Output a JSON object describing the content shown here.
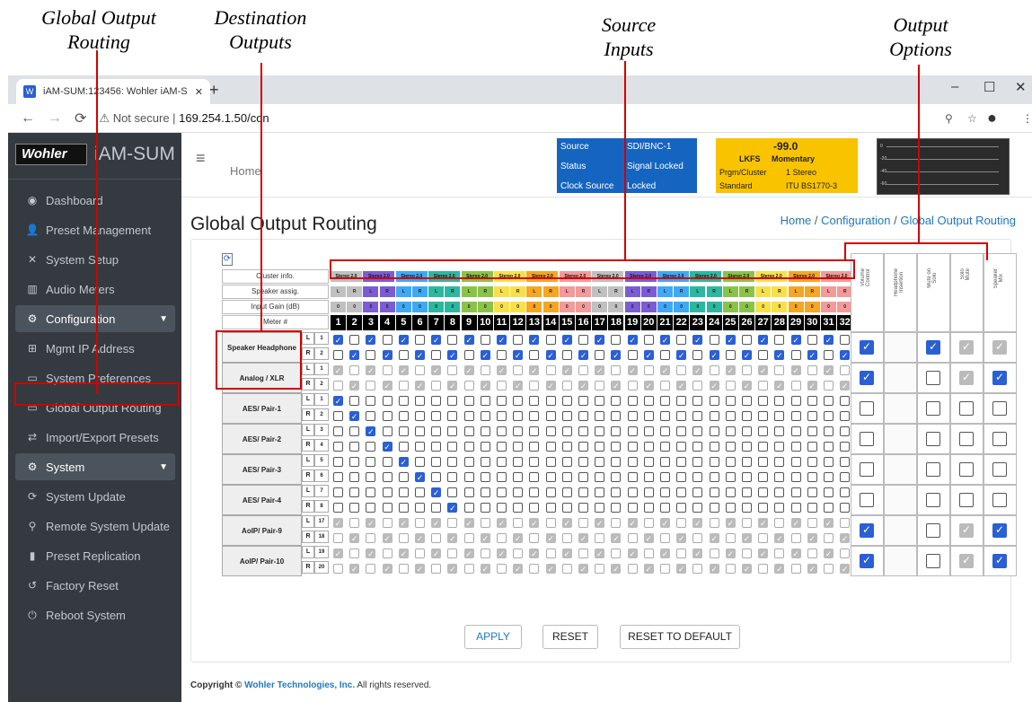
{
  "annotations": {
    "global_output_routing": [
      "Global Output",
      "Routing"
    ],
    "destination_outputs": [
      "Destination",
      "Outputs"
    ],
    "source_inputs": [
      "Source",
      "Inputs"
    ],
    "output_options": [
      "Output",
      "Options"
    ]
  },
  "browser": {
    "tab_title": "iAM-SUM:123456: Wohler iAM-S",
    "url_prefix": "Not secure",
    "url": "169.254.1.50/con"
  },
  "brand": {
    "logo": "Wohler",
    "name": "iAM-SUM"
  },
  "sidebar": {
    "items": [
      {
        "label": "Dashboard",
        "icon": "dashboard-icon",
        "glyph": "◉"
      },
      {
        "label": "Preset Management",
        "icon": "users-icon",
        "glyph": "👤"
      },
      {
        "label": "System Setup",
        "icon": "tools-icon",
        "glyph": "✕"
      },
      {
        "label": "Audio Meters",
        "icon": "chart-icon",
        "glyph": "▥"
      },
      {
        "label": "Configuration",
        "icon": "gear-icon",
        "glyph": "⚙",
        "section": true
      },
      {
        "label": "Mgmt IP Address",
        "icon": "network-icon",
        "glyph": "⊞"
      },
      {
        "label": "System Preferences",
        "icon": "keyboard-icon",
        "glyph": "▭"
      },
      {
        "label": "Global Output Routing",
        "icon": "keyboard-icon",
        "glyph": "▭"
      },
      {
        "label": "Import/Export Presets",
        "icon": "exchange-icon",
        "glyph": "⇄"
      },
      {
        "label": "System",
        "icon": "cogs-icon",
        "glyph": "⚙",
        "section": true
      },
      {
        "label": "System Update",
        "icon": "sync-icon",
        "glyph": "⟳"
      },
      {
        "label": "Remote System Update",
        "icon": "remote-icon",
        "glyph": "⚲"
      },
      {
        "label": "Preset Replication",
        "icon": "copy-icon",
        "glyph": "▮"
      },
      {
        "label": "Factory Reset",
        "icon": "undo-icon",
        "glyph": "↺"
      },
      {
        "label": "Reboot System",
        "icon": "power-icon",
        "glyph": "⏻"
      }
    ]
  },
  "topnav": {
    "home": "Home"
  },
  "status": {
    "source_label": "Source",
    "source_value": "SDI/BNC-1",
    "status_label": "Status",
    "status_value": "Signal Locked",
    "clock_label": "Clock Source",
    "clock_value": "Locked"
  },
  "loudness": {
    "value": "-99.0",
    "unit": "LKFS",
    "mode": "Momentary",
    "prgm_label": "Prgm/Cluster",
    "prgm_value": "1 Stereo",
    "standard_label": "Standard",
    "standard_value": "ITU BS1770-3"
  },
  "meter": {
    "ticks": [
      "0",
      "-20",
      "-40",
      "-60"
    ]
  },
  "page": {
    "title": "Global Output Routing",
    "breadcrumb_home": "Home",
    "breadcrumb_sep": "/",
    "breadcrumb_config": "Configuration",
    "breadcrumb_current": "Global Output Routing"
  },
  "matrix": {
    "row_labels": {
      "cluster": "Cluster info.",
      "speaker": "Speaker assig.",
      "gain": "Input Gain (dB)",
      "meter": "Meter #"
    },
    "cluster_label": "Stereo 2.0",
    "cluster_colors": [
      "#c0c0c0",
      "#7c5cd6",
      "#3fa9f5",
      "#2cb8a0",
      "#8bc34a",
      "#f9e04b",
      "#f5a623",
      "#f49a9a",
      "#c0c0c0",
      "#7c5cd6",
      "#3fa9f5",
      "#2cb8a0",
      "#8bc34a",
      "#f9e04b",
      "#f5a623",
      "#f49a9a"
    ],
    "speaker": [
      "L",
      "R"
    ],
    "gain": "0",
    "meters": [
      "1",
      "2",
      "3",
      "4",
      "5",
      "6",
      "7",
      "8",
      "9",
      "10",
      "11",
      "12",
      "13",
      "14",
      "15",
      "16",
      "17",
      "18",
      "19",
      "20",
      "21",
      "22",
      "23",
      "24",
      "25",
      "26",
      "27",
      "28",
      "29",
      "30",
      "31",
      "32"
    ],
    "destinations": [
      {
        "name": "Speaker Headphone",
        "channels": [
          "1",
          "2"
        ],
        "mode": "alt",
        "enabled": true
      },
      {
        "name": "Analog / XLR",
        "channels": [
          "1",
          "2"
        ],
        "mode": "altdis",
        "enabled": false
      },
      {
        "name": "AES/ Pair-1",
        "channels": [
          "1",
          "2"
        ],
        "mode": "single",
        "first": 0,
        "enabled": true
      },
      {
        "name": "AES/ Pair-2",
        "channels": [
          "3",
          "4"
        ],
        "mode": "single",
        "first": 2,
        "enabled": true
      },
      {
        "name": "AES/ Pair-3",
        "channels": [
          "5",
          "6"
        ],
        "mode": "single",
        "first": 4,
        "enabled": true
      },
      {
        "name": "AES/ Pair-4",
        "channels": [
          "7",
          "8"
        ],
        "mode": "single",
        "first": 6,
        "enabled": true
      },
      {
        "name": "AoIP/ Pair-9",
        "channels": [
          "17",
          "18"
        ],
        "mode": "altdis",
        "enabled": false
      },
      {
        "name": "AoIP/ Pair-10",
        "channels": [
          "19",
          "20"
        ],
        "mode": "altdis",
        "enabled": false
      }
    ],
    "lr": [
      "L",
      "R"
    ],
    "options_headers": [
      "Volume Control",
      "Headphone Insertion",
      "Mute on Solo",
      "Solo Mute",
      "Speaker Mix"
    ],
    "options_headers_display": [
      "Volume\nControl",
      "Headphone\nInsertion",
      "Mute on\nSolo",
      "Solo\nMute",
      "Speaker\nMix"
    ],
    "options": [
      [
        "on",
        "on",
        "dison",
        "dison"
      ],
      [
        "on",
        "off",
        "dison",
        "on"
      ],
      [
        "off",
        "off",
        "off",
        "off"
      ],
      [
        "off",
        "off",
        "off",
        "off"
      ],
      [
        "off",
        "off",
        "off",
        "off"
      ],
      [
        "off",
        "off",
        "off",
        "off"
      ],
      [
        "on",
        "off",
        "dison",
        "on"
      ],
      [
        "on",
        "off",
        "dison",
        "on"
      ]
    ]
  },
  "buttons": {
    "apply": "APPLY",
    "reset": "RESET",
    "reset_default": "RESET TO DEFAULT"
  },
  "footer": {
    "prefix": "Copyright ©",
    "company": "Wohler Technologies, Inc.",
    "suffix": "All rights reserved."
  }
}
